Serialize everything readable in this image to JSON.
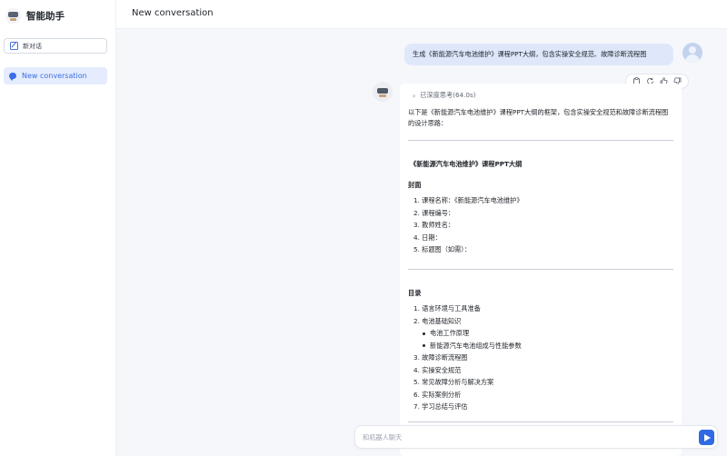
{
  "app": {
    "name": "智能助手"
  },
  "sidebar": {
    "new_chat_label": "新对话",
    "conversations": [
      {
        "label": "New conversation"
      }
    ]
  },
  "header": {
    "title": "New conversation"
  },
  "chat": {
    "user_message": "生成《新能源汽车电池维护》课程PPT大纲，包含实操安全规范、故障诊断流程图",
    "thinking_label": "已深度思考(64.0s)",
    "intro": "以下是《新能源汽车电池维护》课程PPT大纲的框架，包含实操安全规范和故障诊断流程图的设计思路：",
    "outline_title": "《新能源汽车电池维护》课程PPT大纲",
    "cover": {
      "heading": "封面",
      "items": [
        "1. 课程名称：《新能源汽车电池维护》",
        "2. 课程编号：",
        "3. 教师姓名：",
        "4. 日期：",
        "5. 标题图（如需）："
      ]
    },
    "toc": {
      "heading": "目录",
      "items": [
        "1. 语言环境与工具准备",
        "2. 电池基础知识",
        "电池工作原理",
        "新能源汽车电池组成与性能参数",
        "3. 故障诊断流程图",
        "4. 实操安全规范",
        "5. 常见故障分析与解决方案",
        "6. 实际案例分析",
        "7. 学习总结与评估"
      ]
    }
  },
  "input": {
    "placeholder": "和机器人聊天"
  },
  "icons": {
    "copy": "copy-icon",
    "refresh": "refresh-icon",
    "like": "thumbs-up-icon",
    "dislike": "thumbs-down-icon",
    "send": "send-icon"
  },
  "colors": {
    "accent": "#2f6ae3",
    "user_bubble": "#dfe8fb",
    "active_item": "#e4ecfd"
  }
}
